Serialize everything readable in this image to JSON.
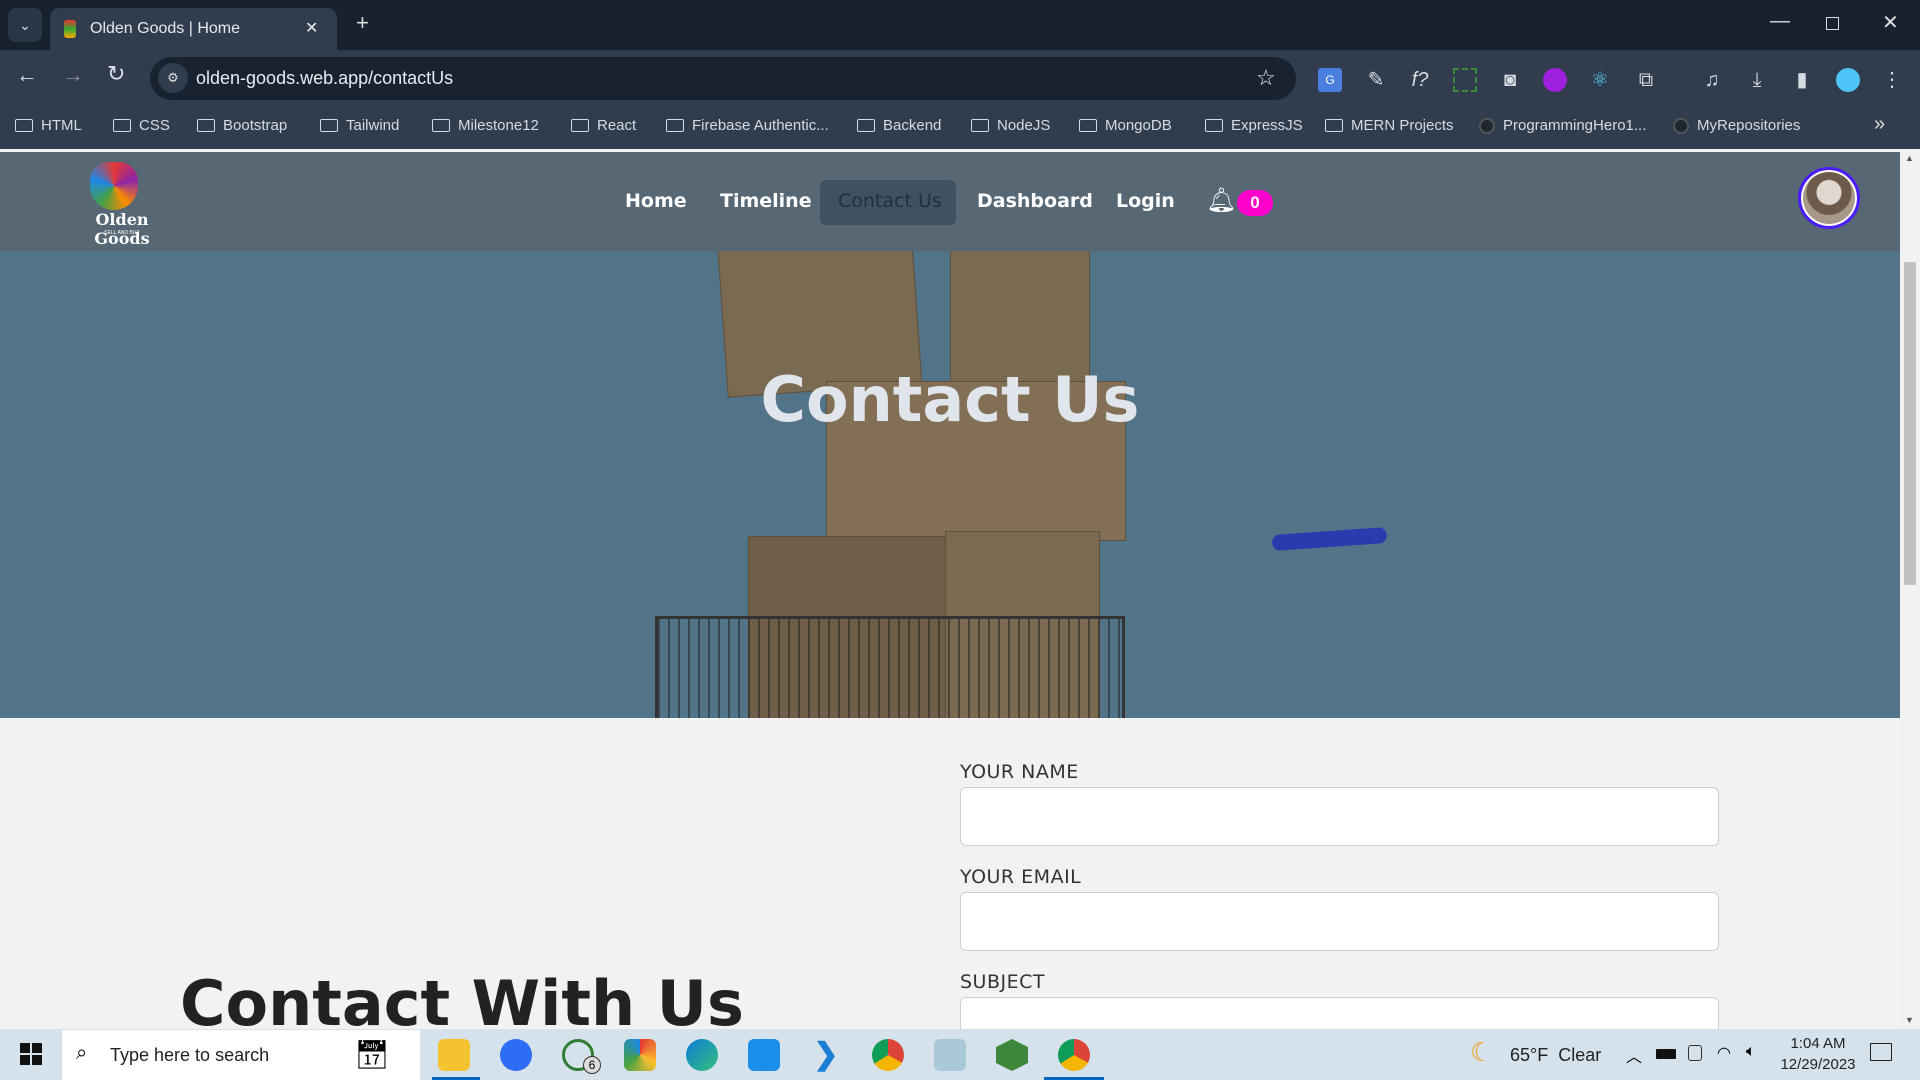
{
  "browser": {
    "tab_title": "Olden Goods | Home",
    "url": "olden-goods.web.app/contactUs",
    "bookmarks": [
      "HTML",
      "CSS",
      "Bootstrap",
      "Tailwind",
      "Milestone12",
      "React",
      "Firebase Authentic...",
      "Backend",
      "NodeJS",
      "MongoDB",
      "ExpressJS",
      "MERN Projects",
      "ProgrammingHero1...",
      "MyRepositories"
    ]
  },
  "nav": {
    "logo": "Olden Goods",
    "logo_tagline": "SELL AND BUY",
    "items": [
      "Home",
      "Timeline",
      "Contact Us",
      "Dashboard",
      "Login"
    ],
    "active": "Contact Us",
    "notification_count": "0"
  },
  "hero": {
    "title": "Contact Us"
  },
  "form": {
    "name_label": "YOUR NAME",
    "email_label": "YOUR EMAIL",
    "subject_label": "SUBJECT",
    "name_value": "",
    "email_value": "",
    "subject_value": ""
  },
  "section": {
    "title": "Contact With Us"
  },
  "taskbar": {
    "search_placeholder": "Type here to search",
    "whatsapp_badge": "6",
    "weather": "65°F  Clear",
    "time": "1:04 AM",
    "date": "12/29/2023"
  },
  "colors": {
    "badge": "#ff00cc",
    "avatar_ring": "#4b1cff",
    "hero_bg": "#527489"
  }
}
